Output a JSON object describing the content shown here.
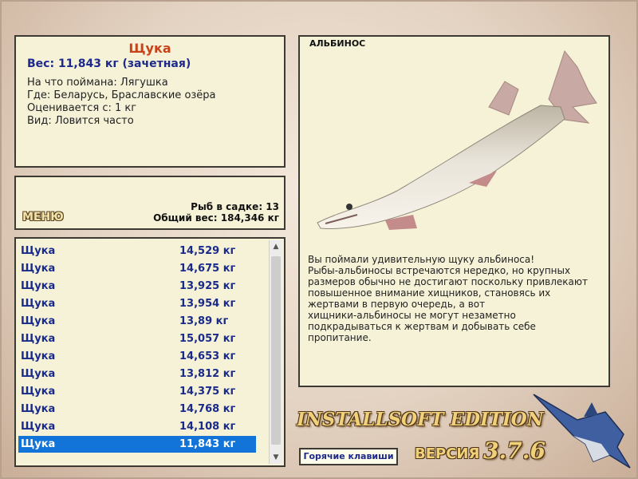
{
  "info": {
    "fish_name": "Щука",
    "weight_line": "Вес: 11,843 кг (зачетная)",
    "bait": "На что поймана: Лягушка",
    "place": "Где: Беларусь, Браславские озёра",
    "rated_from": "Оценивается с: 1 кг",
    "kind": "Вид: Ловится часто"
  },
  "menu": {
    "menu_label": "МЕНЮ",
    "fish_count": "Рыб в садке: 13",
    "total_weight": "Общий вес: 184,346 кг"
  },
  "catch_list": [
    {
      "name": "Щука",
      "weight": "14,529 кг"
    },
    {
      "name": "Щука",
      "weight": "14,675 кг"
    },
    {
      "name": "Щука",
      "weight": "13,925 кг"
    },
    {
      "name": "Щука",
      "weight": "13,954 кг"
    },
    {
      "name": "Щука",
      "weight": "13,89 кг"
    },
    {
      "name": "Щука",
      "weight": "15,057 кг"
    },
    {
      "name": "Щука",
      "weight": "14,653 кг"
    },
    {
      "name": "Щука",
      "weight": "13,812 кг"
    },
    {
      "name": "Щука",
      "weight": "14,375 кг"
    },
    {
      "name": "Щука",
      "weight": "14,768 кг"
    },
    {
      "name": "Щука",
      "weight": "14,108 кг"
    },
    {
      "name": "Щука",
      "weight": "11,843 кг",
      "selected": true
    }
  ],
  "description": {
    "label": "АЛЬБИНОС",
    "lines": [
      "Вы поймали удивительную щуку альбиноса!",
      "Рыбы-альбиносы встречаются нередко, но крупных",
      "размеров обычно не достигают поскольку привлекают",
      "повышенное внимание хищников, становясь их",
      "жертвами в первую очередь, а вот",
      "хищники-альбиносы не могут незаметно",
      "подкрадываться к жертвам и добывать себе",
      "пропитание."
    ]
  },
  "footer": {
    "edition": "INSTALLSOFT EDITION",
    "hotkeys": "Горячие клавиши",
    "version_label": "ВЕРСИЯ",
    "version": "3.7.6"
  },
  "colors": {
    "panel_bg": "#f6f2d7",
    "selected_row": "#1273d8",
    "fish_name": "#c8431a",
    "weight_text": "#1d2a8c"
  },
  "icons": {
    "scroll_up": "triangle-up",
    "scroll_down": "triangle-down",
    "fish_picture": "albino-pike",
    "logo_picture": "marlin"
  }
}
